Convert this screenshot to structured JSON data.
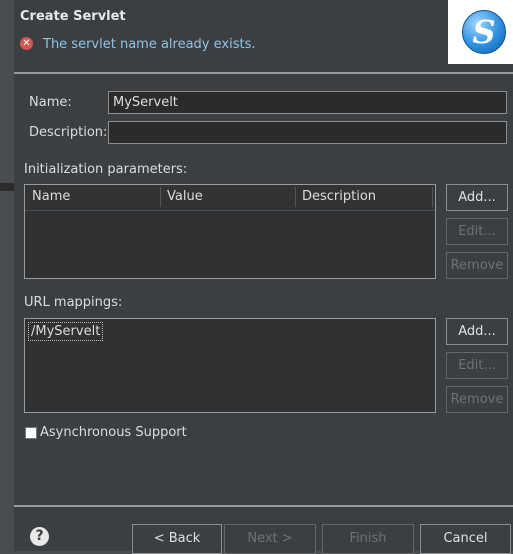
{
  "dialog": {
    "title": "Create Servlet",
    "error_message": "The servlet name already exists.",
    "logo_letter": "S"
  },
  "form": {
    "name_label": "Name:",
    "name_value": "MyServelt",
    "description_label": "Description:",
    "description_value": ""
  },
  "init_params": {
    "label": "Initialization parameters:",
    "columns": [
      "Name",
      "Value",
      "Description"
    ],
    "buttons": {
      "add": "Add...",
      "edit": "Edit...",
      "remove": "Remove"
    }
  },
  "url_mappings": {
    "label": "URL mappings:",
    "items": [
      "/MyServelt"
    ],
    "buttons": {
      "add": "Add...",
      "edit": "Edit...",
      "remove": "Remove"
    }
  },
  "async": {
    "label": "Asynchronous Support",
    "checked": false
  },
  "footer": {
    "help": "?",
    "back": "< Back",
    "next": "Next >",
    "finish": "Finish",
    "cancel": "Cancel"
  }
}
